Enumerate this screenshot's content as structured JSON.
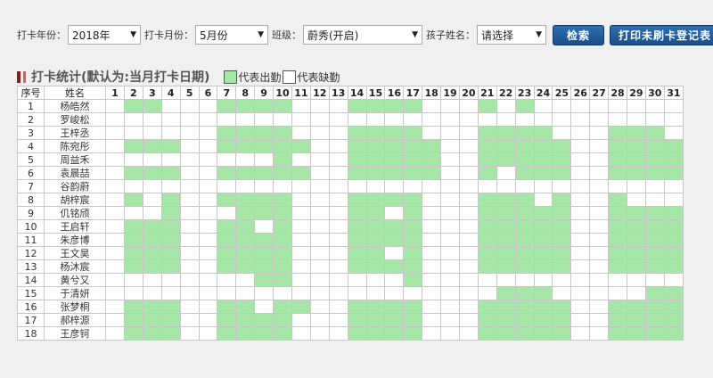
{
  "filters": {
    "year_label": "打卡年份：",
    "year_value": "2018年",
    "month_label": "打卡月份：",
    "month_value": "5月份",
    "class_label": "班级：",
    "class_value": "蔚秀(开启)",
    "child_label": "孩子姓名：",
    "child_value": "请选择",
    "search_button": "检索",
    "print_button": "打印未刷卡登记表"
  },
  "section": {
    "title": "打卡统计(默认为:当月打卡日期)",
    "legend_present": "代表出勤",
    "legend_absent": "代表缺勤"
  },
  "colors": {
    "present": "#a6e6a6",
    "absent": "#ffffff",
    "button": "#1f5c99",
    "title_mark": "#8b1a1a"
  },
  "table": {
    "col_index": "序号",
    "col_name": "姓名",
    "days": [
      "1",
      "2",
      "3",
      "4",
      "5",
      "6",
      "7",
      "8",
      "9",
      "10",
      "11",
      "12",
      "13",
      "14",
      "15",
      "16",
      "17",
      "18",
      "19",
      "20",
      "21",
      "22",
      "23",
      "24",
      "25",
      "26",
      "27",
      "28",
      "29",
      "30",
      "31"
    ],
    "rows": [
      {
        "no": "1",
        "name": "杨皓然",
        "present": [
          2,
          3,
          7,
          8,
          9,
          10,
          14,
          15,
          16,
          17,
          21,
          23
        ]
      },
      {
        "no": "2",
        "name": "罗峻松",
        "present": []
      },
      {
        "no": "3",
        "name": "王梓丞",
        "present": [
          7,
          8,
          9,
          10,
          14,
          15,
          16,
          17,
          21,
          22,
          23,
          24,
          28,
          29,
          30
        ]
      },
      {
        "no": "4",
        "name": "陈宛彤",
        "present": [
          2,
          3,
          4,
          7,
          8,
          9,
          10,
          11,
          14,
          15,
          16,
          17,
          18,
          21,
          22,
          23,
          24,
          25,
          28,
          29,
          30,
          31
        ]
      },
      {
        "no": "5",
        "name": "周益禾",
        "present": [
          10,
          14,
          15,
          16,
          17,
          18,
          21,
          22,
          23,
          24,
          25,
          28,
          29,
          30,
          31
        ]
      },
      {
        "no": "6",
        "name": "袁晨喆",
        "present": [
          2,
          3,
          4,
          7,
          8,
          9,
          10,
          11,
          14,
          15,
          16,
          17,
          18,
          21,
          23,
          24,
          25,
          28,
          29,
          30,
          31
        ]
      },
      {
        "no": "7",
        "name": "谷韵蔚",
        "present": []
      },
      {
        "no": "8",
        "name": "胡梓宸",
        "present": [
          2,
          4,
          7,
          8,
          9,
          10,
          14,
          15,
          16,
          17,
          21,
          22,
          23,
          25,
          28
        ]
      },
      {
        "no": "9",
        "name": "仉铭颀",
        "present": [
          4,
          8,
          9,
          10,
          14,
          15,
          17,
          21,
          22,
          23,
          24,
          25,
          28,
          29,
          30,
          31
        ]
      },
      {
        "no": "10",
        "name": "王启轩",
        "present": [
          2,
          3,
          4,
          7,
          8,
          10,
          14,
          15,
          16,
          17,
          21,
          22,
          23,
          24,
          25,
          28,
          29,
          30,
          31
        ]
      },
      {
        "no": "11",
        "name": "朱彦博",
        "present": [
          2,
          3,
          4,
          7,
          8,
          9,
          10,
          14,
          15,
          16,
          17,
          21,
          22,
          23,
          24,
          25,
          28,
          29,
          30,
          31
        ]
      },
      {
        "no": "12",
        "name": "王文昊",
        "present": [
          2,
          3,
          4,
          7,
          8,
          9,
          10,
          14,
          15,
          17,
          21,
          22,
          23,
          24,
          25,
          28,
          29,
          30,
          31
        ]
      },
      {
        "no": "13",
        "name": "杨沐宸",
        "present": [
          2,
          3,
          4,
          7,
          8,
          9,
          10,
          14,
          15,
          16,
          17,
          21,
          22,
          23,
          24,
          25,
          28,
          29,
          30,
          31
        ]
      },
      {
        "no": "14",
        "name": "黄兮又",
        "present": [
          9,
          10,
          17
        ]
      },
      {
        "no": "15",
        "name": "于清妍",
        "present": [
          22,
          23,
          24,
          30,
          31
        ]
      },
      {
        "no": "16",
        "name": "张梦桐",
        "present": [
          2,
          3,
          4,
          7,
          8,
          10,
          11,
          14,
          15,
          16,
          17,
          21,
          22,
          23,
          24,
          25,
          28,
          29,
          30,
          31
        ]
      },
      {
        "no": "17",
        "name": "郝梓源",
        "present": [
          2,
          3,
          4,
          7,
          8,
          9,
          10,
          14,
          15,
          16,
          17,
          21,
          22,
          23,
          24,
          25,
          28,
          29,
          30,
          31
        ]
      },
      {
        "no": "18",
        "name": "王彦钶",
        "present": [
          2,
          3,
          4,
          7,
          8,
          9,
          10,
          14,
          15,
          16,
          17,
          21,
          22,
          23,
          24,
          25,
          28,
          29,
          30,
          31
        ]
      }
    ]
  }
}
